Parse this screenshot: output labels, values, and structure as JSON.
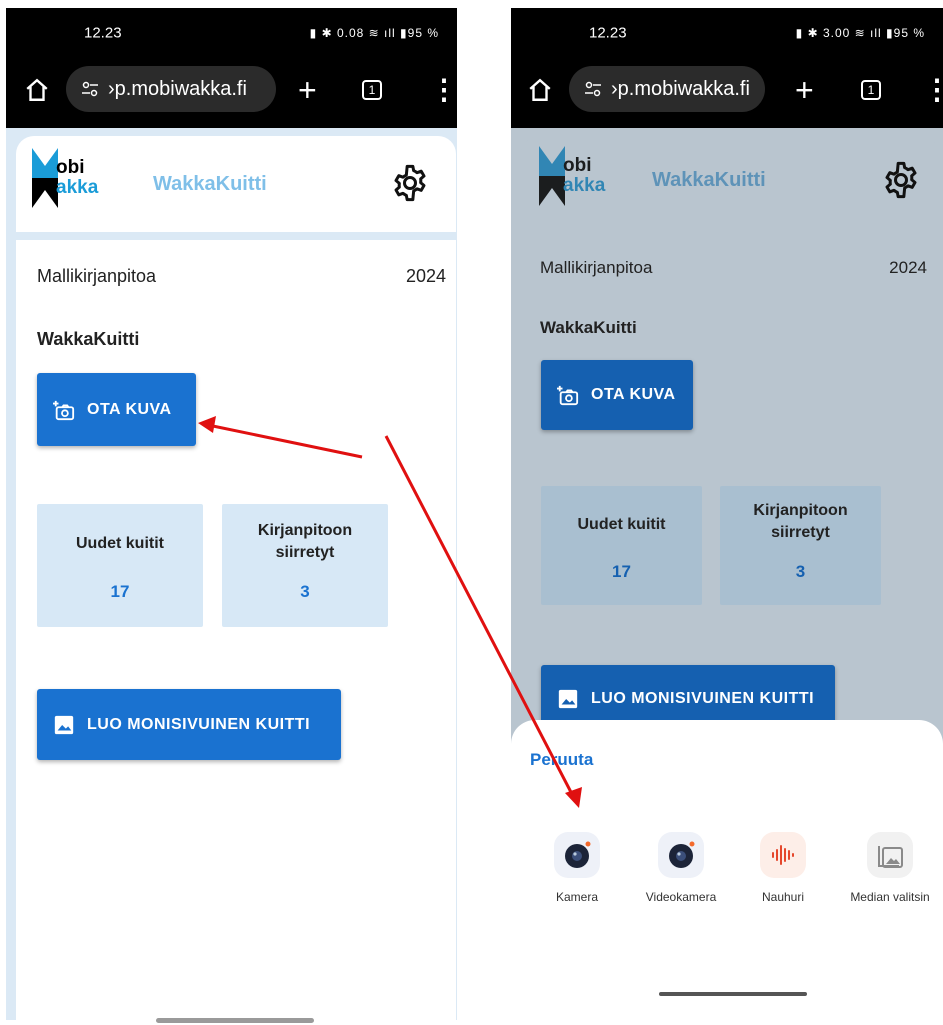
{
  "left": {
    "status": {
      "time": "12.23",
      "icons": "▮ ✱ 0.08 ≋ ıll ▮95 %"
    },
    "browser": {
      "url": "›p.mobiwakka.fi",
      "tab_count": "1"
    },
    "header": {
      "logo_top": "obi",
      "logo_bottom": "akka",
      "title": "WakkaKuitti"
    },
    "company": "Mallikirjanpitoa",
    "year": "2024",
    "section_title": "WakkaKuitti",
    "take_photo_label": "OTA KUVA",
    "stats": [
      {
        "label": "Uudet kuitit",
        "value": "17"
      },
      {
        "label": "Kirjanpitoon siirretyt",
        "value": "3"
      }
    ],
    "multipage_label": "LUO MONISIVUINEN KUITTI"
  },
  "right": {
    "status": {
      "time": "12.23",
      "icons": "▮ ✱ 3.00 ≋ ıll ▮95 %"
    },
    "browser": {
      "url": "›p.mobiwakka.fi",
      "tab_count": "1"
    },
    "header": {
      "logo_top": "obi",
      "logo_bottom": "akka",
      "title": "WakkaKuitti"
    },
    "company": "Mallikirjanpitoa",
    "year": "2024",
    "section_title": "WakkaKuitti",
    "take_photo_label": "OTA KUVA",
    "stats": [
      {
        "label": "Uudet kuitit",
        "value": "17"
      },
      {
        "label": "Kirjanpitoon siirretyt",
        "value": "3"
      }
    ],
    "multipage_label": "LUO MONISIVUINEN KUITTI",
    "sheet": {
      "cancel_label": "Peruuta",
      "apps": [
        {
          "name": "Kamera",
          "icon": "camera-icon"
        },
        {
          "name": "Videokamera",
          "icon": "video-camera-icon"
        },
        {
          "name": "Nauhuri",
          "icon": "voice-recorder-icon"
        },
        {
          "name": "Median valitsin",
          "icon": "media-picker-icon"
        }
      ]
    }
  },
  "colors": {
    "primary": "#1a72d0",
    "stat_bg": "#d7e8f6",
    "brand_light": "#7fbfe8",
    "arrow": "#e01010"
  }
}
